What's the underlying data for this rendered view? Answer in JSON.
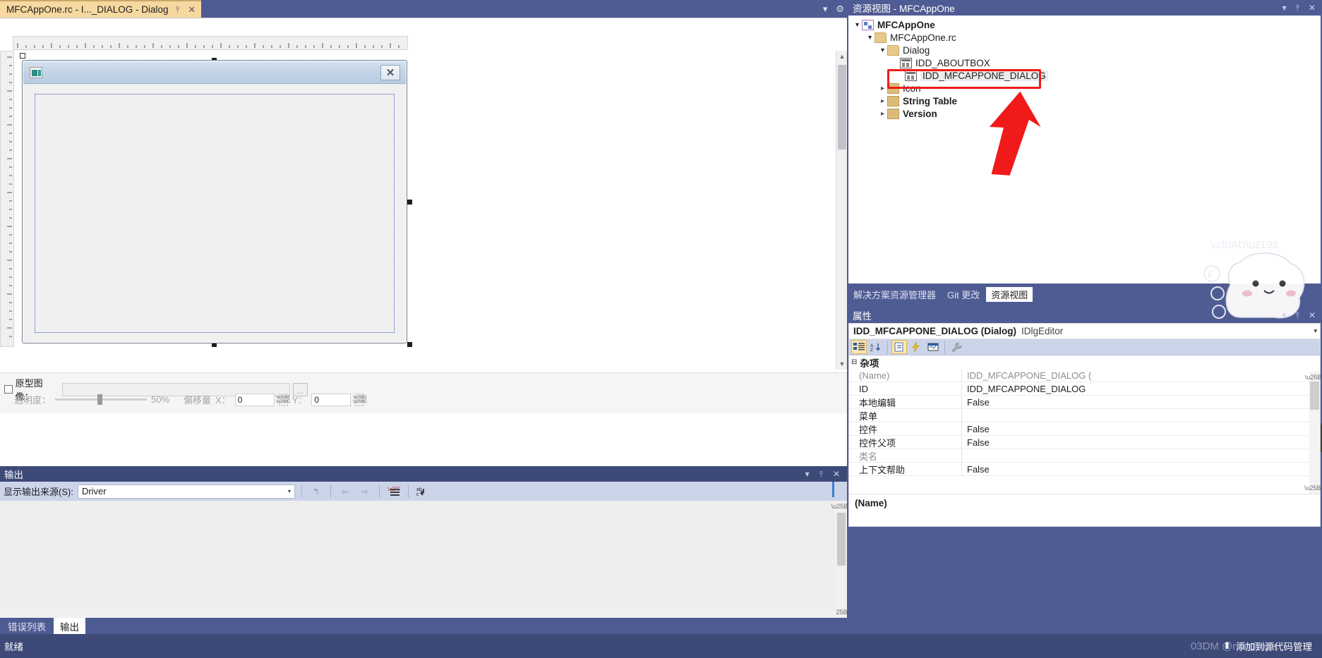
{
  "editor": {
    "tab": {
      "label": "MFCAppOne.rc - I..._DIALOG - Dialog",
      "pin_icon": "⫯",
      "close_icon": "✕"
    },
    "tabstrip_right": {
      "dropdown_icon": "▾",
      "settings_icon": "⚙"
    },
    "dialog": {
      "sysmenu_icon": "dialog-system-icon",
      "close_icon": "✕",
      "caption": ""
    },
    "prototype": {
      "checkbox_label": "原型图像：",
      "path_value": "",
      "browse_label": "...",
      "transparency_label": "透明度：",
      "transparency_value": "50%",
      "offset_label": "偏移量",
      "x_label": "X：",
      "x_value": "0",
      "y_label": "Y：",
      "y_value": "0"
    },
    "scroll_up": "▲",
    "scroll_down": "▼"
  },
  "output": {
    "title": "输出",
    "header_icons": {
      "dropdown": "▾",
      "pin": "⫯",
      "close": "✕"
    },
    "source_label": "显示输出来源(S):",
    "source_value": "Driver",
    "combo_arrow": "▾",
    "toolbar_icons": [
      {
        "name": "go-to-message-icon",
        "glyph": "↰",
        "enabled": false
      },
      {
        "name": "previous-message-icon",
        "glyph": "⇦",
        "enabled": false
      },
      {
        "name": "next-message-icon",
        "glyph": "⇨",
        "enabled": false
      },
      {
        "name": "clear-all-icon",
        "glyph": "✕",
        "enabled": true
      },
      {
        "name": "toggle-word-wrap-icon",
        "glyph": "↵",
        "enabled": true
      }
    ],
    "content": ""
  },
  "bottom_tabs": [
    {
      "label": "错误列表",
      "active": false
    },
    {
      "label": "输出",
      "active": true
    }
  ],
  "resource_view": {
    "title": "资源视图 - MFCAppOne",
    "header_icons": {
      "dropdown": "▾",
      "pin": "⫯",
      "close": "✕"
    },
    "tree": [
      {
        "label": "MFCAppOne",
        "indent": 0,
        "twisty": "open",
        "icon": "project-icon",
        "bold": true,
        "selected": false
      },
      {
        "label": "MFCAppOne.rc",
        "indent": 1,
        "twisty": "open",
        "icon": "folder-open-icon",
        "bold": false,
        "selected": false
      },
      {
        "label": "Dialog",
        "indent": 2,
        "twisty": "open",
        "icon": "folder-open-icon",
        "bold": false,
        "selected": false
      },
      {
        "label": "IDD_ABOUTBOX",
        "indent": 3,
        "twisty": "none",
        "icon": "dialog-resource-icon",
        "bold": false,
        "selected": false
      },
      {
        "label": "IDD_MFCAPPONE_DIALOG",
        "indent": 3,
        "twisty": "none",
        "icon": "dialog-resource-icon",
        "bold": false,
        "selected": true
      },
      {
        "label": "Icon",
        "indent": 2,
        "twisty": "closed",
        "icon": "folder-icon",
        "bold": false,
        "selected": false
      },
      {
        "label": "String Table",
        "indent": 2,
        "twisty": "closed",
        "icon": "folder-icon",
        "bold": false,
        "selected": false
      },
      {
        "label": "Version",
        "indent": 2,
        "twisty": "closed",
        "icon": "folder-icon",
        "bold": false,
        "selected": false
      }
    ],
    "highlight_color": "#f01a1a",
    "tabs": [
      {
        "label": "解决方案资源管理器",
        "active": false
      },
      {
        "label": "Git 更改",
        "active": false
      },
      {
        "label": "资源视图",
        "active": true
      }
    ]
  },
  "properties": {
    "title": "属性",
    "header_icons": {
      "dropdown": "▾",
      "pin": "⫯",
      "close": "✕"
    },
    "object_name": "IDD_MFCAPPONE_DIALOG (Dialog)",
    "object_type": "IDlgEditor",
    "object_caret": "▾",
    "toolbar": [
      {
        "name": "categorized-button",
        "glyph": "☷",
        "on": true
      },
      {
        "name": "alphabetical-button",
        "glyph": "↓",
        "on": false
      },
      {
        "name": "properties-page-button",
        "glyph": "⚒",
        "on": true
      },
      {
        "name": "events-button",
        "glyph": "⚡",
        "on": false
      },
      {
        "name": "messages-button",
        "glyph": "▤",
        "on": false
      },
      {
        "name": "property-pages-button",
        "glyph": "ὒ7",
        "on": false
      }
    ],
    "category": {
      "expander": "⊟",
      "label": "杂项"
    },
    "rows": [
      {
        "key": "(Name)",
        "value": "IDD_MFCAPPONE_DIALOG (",
        "dim": true
      },
      {
        "key": "ID",
        "value": "IDD_MFCAPPONE_DIALOG",
        "dim": false
      },
      {
        "key": "本地编辑",
        "value": "False",
        "dim": false
      },
      {
        "key": "菜单",
        "value": "",
        "dim": false
      },
      {
        "key": "控件",
        "value": "False",
        "dim": false
      },
      {
        "key": "控件父项",
        "value": "False",
        "dim": false
      },
      {
        "key": "类名",
        "value": "",
        "dim": true
      },
      {
        "key": "上下文帮助",
        "value": "False",
        "dim": false
      }
    ],
    "description": "(Name)"
  },
  "status_bar": {
    "left": "就绪",
    "source_control_icon": "⬆",
    "source_control_label": "添加到源代码管理",
    "watermark": "03DM @raindrops."
  }
}
